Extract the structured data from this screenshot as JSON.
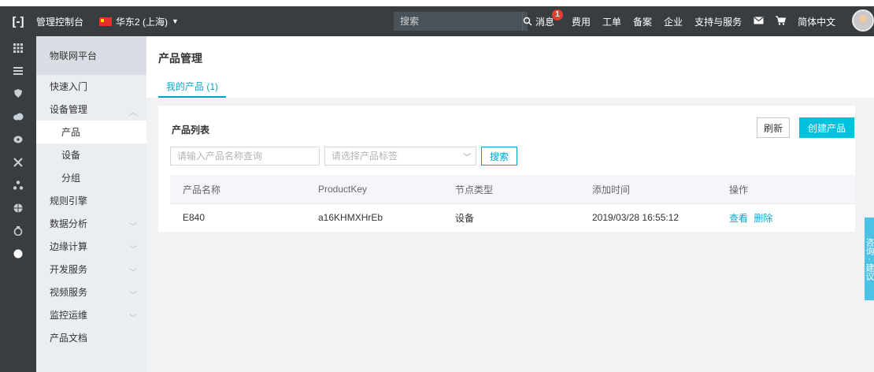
{
  "topbar": {
    "logo": "[-]",
    "console_title": "管理控制台",
    "region": "华东2 (上海)",
    "search_placeholder": "搜索",
    "items": [
      "消息",
      "费用",
      "工单",
      "备案",
      "企业",
      "支持与服务"
    ],
    "message_badge": "1",
    "language": "简体中文"
  },
  "rail": {
    "icons": [
      "grid-icon",
      "list-icon",
      "shield-icon",
      "cloud-icon",
      "database-icon",
      "tools-icon",
      "network-icon",
      "globe-icon",
      "gear-icon",
      "circle-icon"
    ]
  },
  "nav": {
    "header": "物联网平台",
    "items": [
      {
        "label": "快速入门"
      },
      {
        "label": "设备管理"
      },
      {
        "label": "产品"
      },
      {
        "label": "设备"
      },
      {
        "label": "分组"
      },
      {
        "label": "规则引擎"
      },
      {
        "label": "数据分析"
      },
      {
        "label": "边缘计算"
      },
      {
        "label": "开发服务"
      },
      {
        "label": "视频服务"
      },
      {
        "label": "监控运维"
      },
      {
        "label": "产品文档"
      }
    ]
  },
  "main": {
    "title": "产品管理",
    "tab": "我的产品 (1)",
    "card_title": "产品列表",
    "refresh_label": "刷新",
    "create_label": "创建产品",
    "name_placeholder": "请输入产品名称查询",
    "tag_placeholder": "请选择产品标签",
    "search_label": "搜索",
    "columns": [
      "产品名称",
      "ProductKey",
      "节点类型",
      "添加时间",
      "操作"
    ],
    "rows": [
      {
        "name": "E840",
        "key": "a16KHMXHrEb",
        "type": "设备",
        "time": "2019/03/28 16:55:12",
        "view": "查看",
        "delete": "删除"
      }
    ]
  },
  "feedback": "咨询 · 建议"
}
